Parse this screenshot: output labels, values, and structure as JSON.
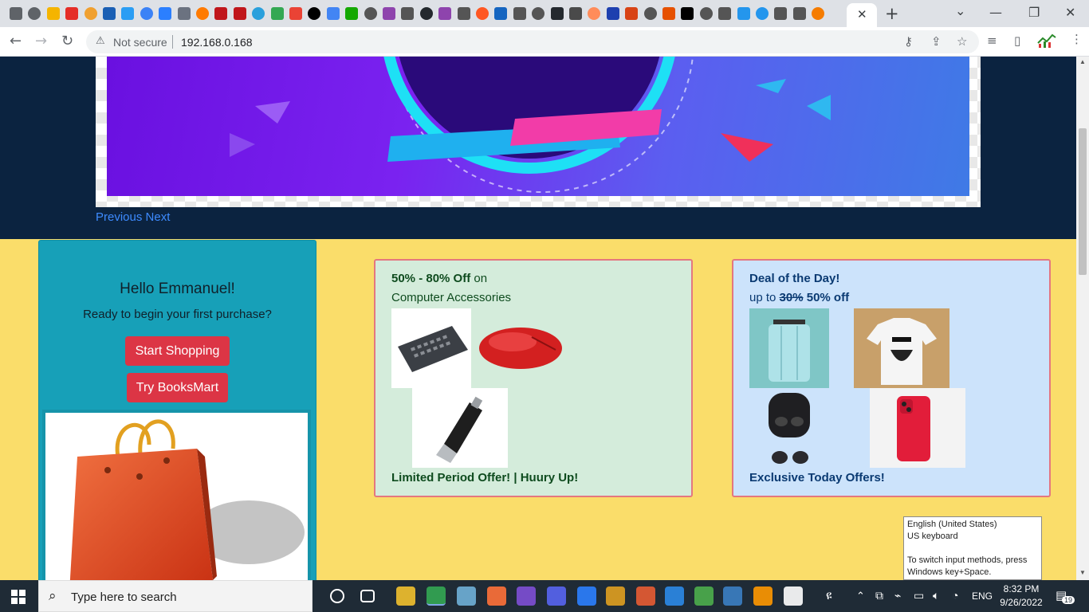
{
  "browser": {
    "address": {
      "security_label": "Not secure",
      "url": "192.168.0.168"
    },
    "window_controls": {
      "minimize": "—",
      "maximize": "❐",
      "close": "✕"
    },
    "new_tab": "+",
    "tab_close": "✕",
    "tab_overflow": "⌄"
  },
  "carousel": {
    "previous_label": "Previous",
    "next_label": "Next"
  },
  "greeting": {
    "title": "Hello Emmanuel!",
    "subtitle": "Ready to begin your first purchase?",
    "start_button": "Start Shopping",
    "books_button": "Try BooksMart"
  },
  "offer_left": {
    "discount": "50% - 80% Off",
    "on_word": " on",
    "category": "Computer Accessories",
    "footer": "Limited Period Offer! | Huury Up!"
  },
  "offer_right": {
    "title": "Deal of the Day!",
    "up_to": "up to ",
    "old_discount": "30%",
    "new_discount": " 50% off",
    "footer": "Exclusive Today Offers!"
  },
  "language_tooltip": {
    "line1": "English (United States)",
    "line2": "US keyboard",
    "line3": "To switch input methods, press",
    "line4": "Windows key+Space."
  },
  "taskbar": {
    "search_placeholder": "Type here to search",
    "language": "ENG",
    "time": "8:32 PM",
    "date": "9/26/2022",
    "notifications": "19"
  },
  "colors": {
    "hero_bg": "#0b2340",
    "main_bg": "#fadd6a",
    "greet_bg": "#17a0b8",
    "button_red": "#dc3545",
    "offer_left_bg": "#d4ecdb",
    "offer_right_bg": "#cce3fb",
    "offer_border": "#e4777f",
    "link_blue": "#3d8bff"
  }
}
